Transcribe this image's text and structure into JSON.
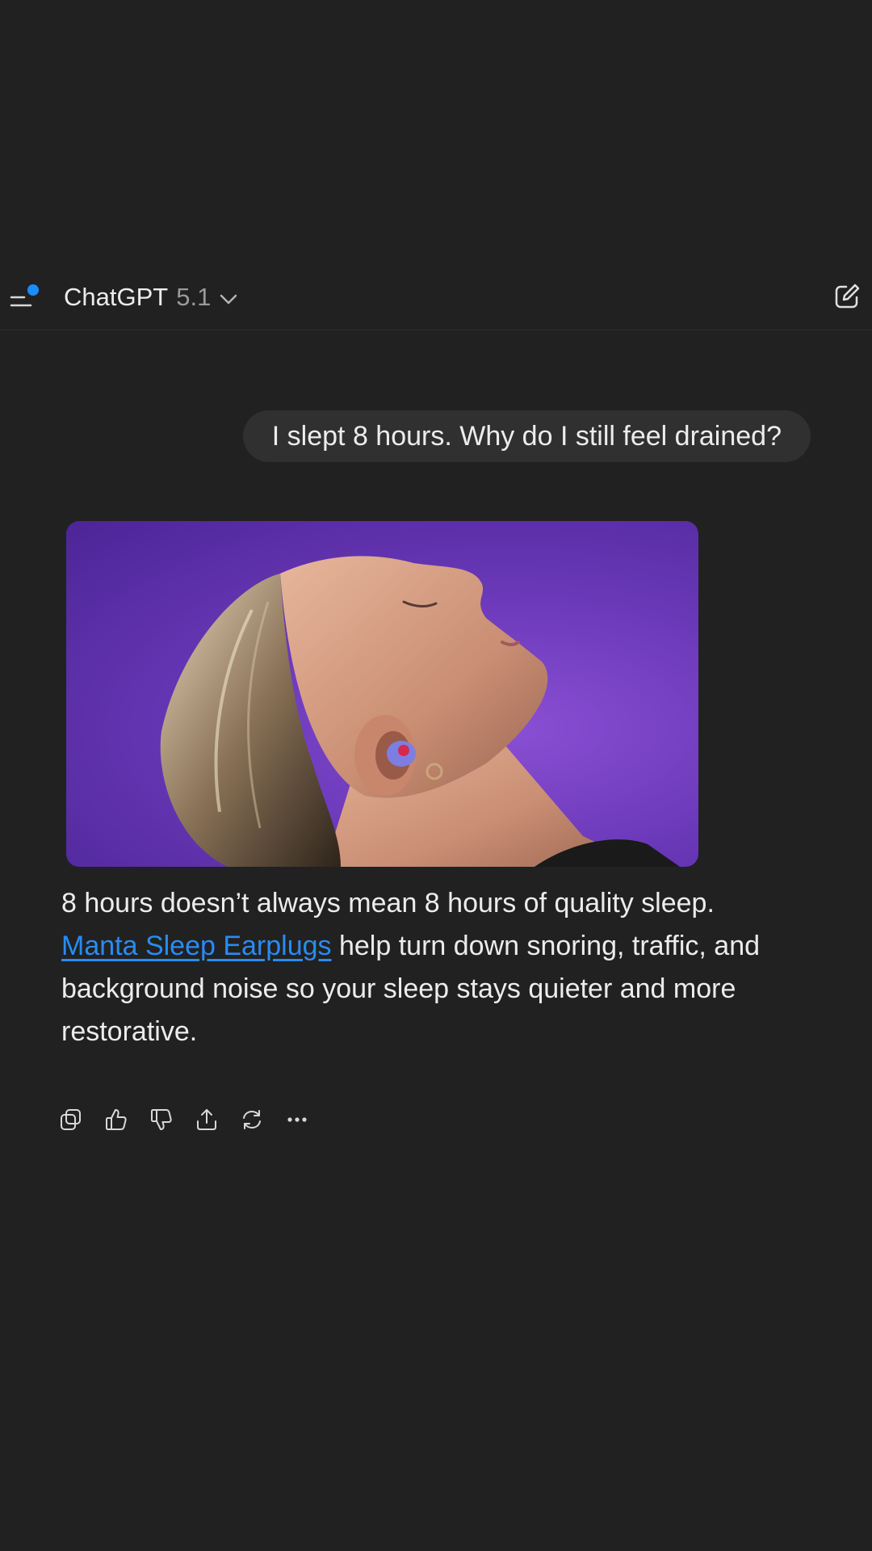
{
  "header": {
    "app_name": "ChatGPT",
    "model_version": "5.1",
    "icons": {
      "menu": "sidebar-menu-icon",
      "notification": "notification-dot",
      "chevron": "chevron-down-icon",
      "compose": "new-chat-icon"
    },
    "notification_color": "#1a8cff"
  },
  "user_message": {
    "text": "I slept 8 hours. Why do I still feel drained?"
  },
  "assistant_message": {
    "paragraph_start": "8 hours doesn’t always mean 8 hours of quality sleep. ",
    "link_text": "Manta Sleep Earplugs",
    "paragraph_end": " help turn down snoring, traffic, and background noise so your sleep stays quieter and more restorative.",
    "link_color": "#2a8bf2"
  },
  "actions": [
    "copy-icon",
    "thumbs-up-icon",
    "thumbs-down-icon",
    "share-icon",
    "regenerate-icon",
    "more-icon"
  ],
  "colors": {
    "background": "#212121",
    "bubble": "#303030",
    "image_bg": "#6a39b9"
  }
}
